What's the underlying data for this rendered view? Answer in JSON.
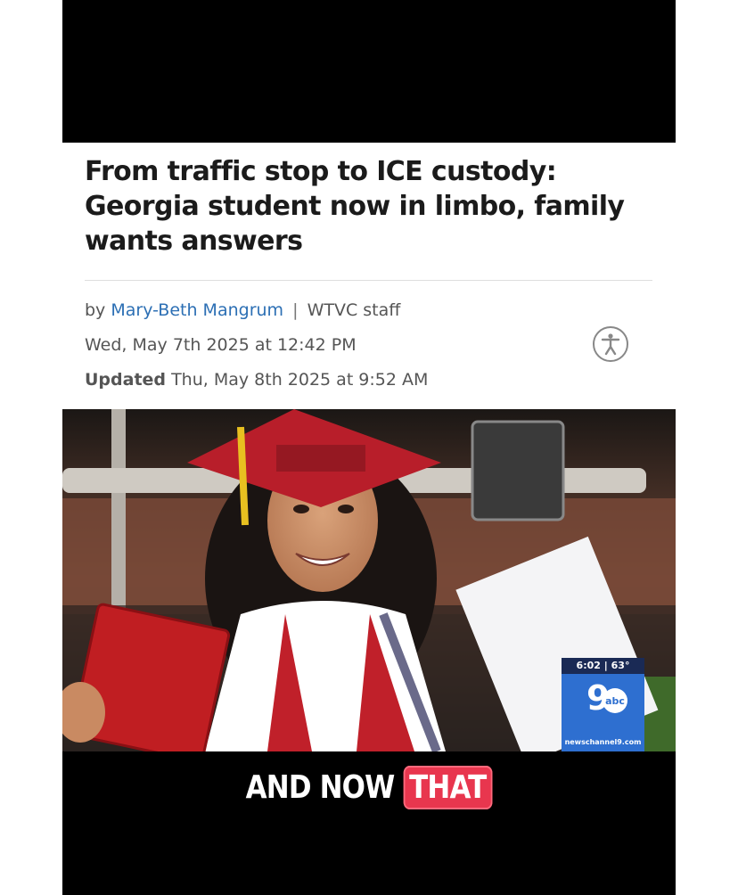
{
  "article": {
    "headline": "From traffic stop to ICE custody: Georgia student now in limbo, family wants answers",
    "byline_prefix": "by",
    "author": "Mary-Beth Mangrum",
    "separator": "|",
    "staff": "WTVC staff",
    "published": "Wed, May 7th 2025 at 12:42 PM",
    "updated_label": "Updated",
    "updated": "Thu, May 8th 2025 at 9:52 AM",
    "accessibility_icon": "accessibility-icon"
  },
  "broadcast": {
    "time": "6:02",
    "divider": "|",
    "temperature": "63°",
    "channel": "9",
    "network": "abc",
    "url": "newschannel9.com"
  },
  "caption": {
    "text_before": "AND NOW ",
    "highlight": "THAT",
    "highlight_color": "#e8364e"
  },
  "colors": {
    "author_link": "#2c6fb4",
    "headline": "#1b1b1b",
    "station_blue": "#2e6fd0"
  }
}
